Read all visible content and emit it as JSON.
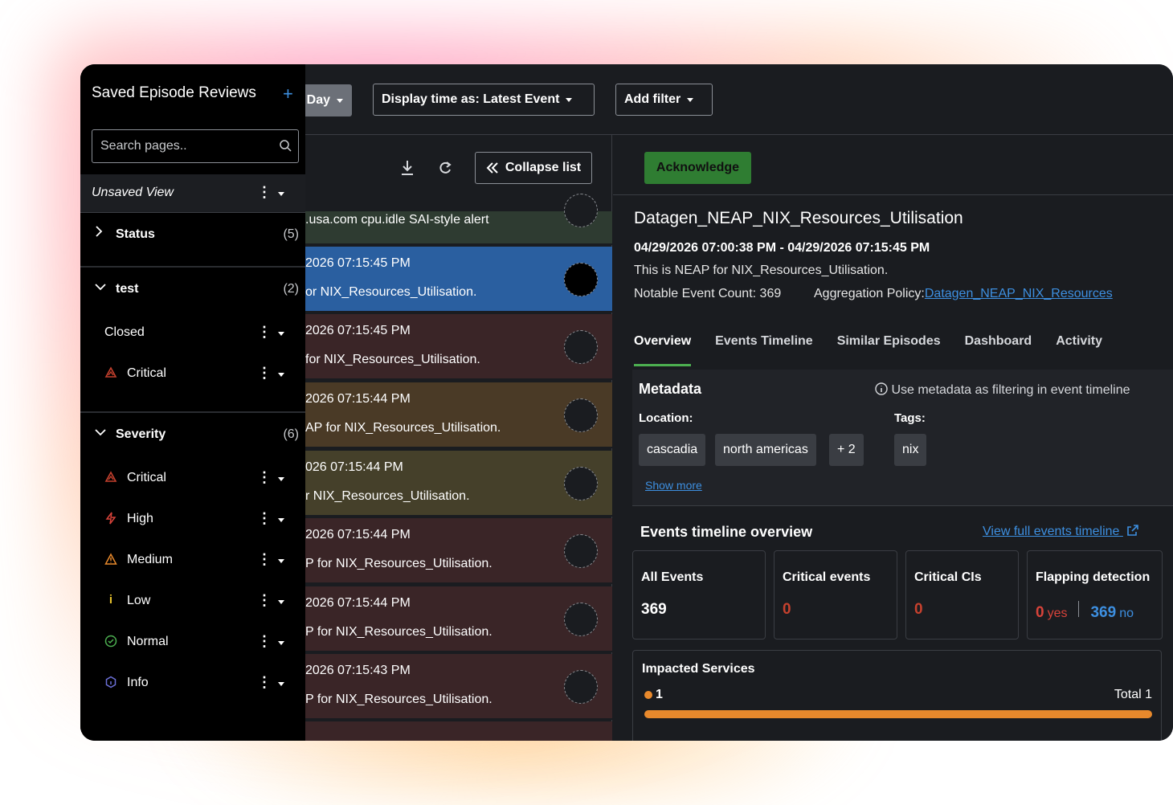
{
  "topbar": {
    "day_label": "Day",
    "display_time_label": "Display time as: Latest Event",
    "add_filter_label": "Add filter"
  },
  "list": {
    "collapse_label": "Collapse list",
    "rows": [
      {
        "line1": ".usa.com cpu.idle SAI-style alert",
        "line2": "",
        "bg": "#2e3b31"
      },
      {
        "line1": "2026 07:15:45 PM",
        "line2": "or NIX_Resources_Utilisation.",
        "bg": "#2a5fa0"
      },
      {
        "line1": "2026 07:15:45 PM",
        "line2": " for NIX_Resources_Utilisation.",
        "bg": "#3a2527"
      },
      {
        "line1": "2026 07:15:44 PM",
        "line2": "AP for NIX_Resources_Utilisation.",
        "bg": "#4a3a26"
      },
      {
        "line1": "026 07:15:44 PM",
        "line2": "r NIX_Resources_Utilisation.",
        "bg": "#45402a"
      },
      {
        "line1": "2026 07:15:44 PM",
        "line2": "P for NIX_Resources_Utilisation.",
        "bg": "#3a2527"
      },
      {
        "line1": "2026 07:15:44 PM",
        "line2": "P for NIX_Resources_Utilisation.",
        "bg": "#3a2527"
      },
      {
        "line1": "2026 07:15:43 PM",
        "line2": "P for NIX_Resources_Utilisation.",
        "bg": "#3a2527"
      }
    ]
  },
  "detail": {
    "acknowledge_label": "Acknowledge",
    "title": "Datagen_NEAP_NIX_Resources_Utilisation",
    "time_range": "04/29/2026 07:00:38 PM - 04/29/2026 07:15:45 PM",
    "description": "This is NEAP for NIX_Resources_Utilisation.",
    "notable_count": "Notable Event Count: 369",
    "aggregation_label": "Aggregation Policy:",
    "aggregation_link": "Datagen_NEAP_NIX_Resources",
    "tabs": [
      "Overview",
      "Events Timeline",
      "Similar Episodes",
      "Dashboard",
      "Activity"
    ],
    "metadata": {
      "title": "Metadata",
      "hint": "Use metadata as filtering in event timeline",
      "location_label": "Location:",
      "tags_label": "Tags:",
      "locations": [
        "cascadia",
        "north americas",
        "+ 2"
      ],
      "tags": [
        "nix"
      ],
      "show_more": "Show more"
    },
    "timeline": {
      "title": "Events timeline overview",
      "link": "View full events timeline",
      "cards": {
        "all_events_label": "All Events",
        "all_events_value": "369",
        "critical_events_label": "Critical events",
        "critical_events_value": "0",
        "critical_cis_label": "Critical CIs",
        "critical_cis_value": "0",
        "flapping_label": "Flapping detection",
        "flapping_yes_value": "0",
        "flapping_yes_label": "yes",
        "flapping_no_value": "369",
        "flapping_no_label": "no"
      }
    },
    "impacted": {
      "title": "Impacted Services",
      "count": "1",
      "total": "Total 1",
      "fraction": 1.0
    }
  },
  "sidebar": {
    "title": "Saved Episode Reviews",
    "plus": "+",
    "search_placeholder": "Search pages..",
    "unsaved_view": "Unsaved View",
    "groups": {
      "status": {
        "name": "Status",
        "count": "(5)"
      },
      "test": {
        "name": "test",
        "count": "(2)",
        "items": [
          "Closed",
          "Critical"
        ]
      },
      "severity": {
        "name": "Severity",
        "count": "(6)",
        "items": [
          "Critical",
          "High",
          "Medium",
          "Low",
          "Normal",
          "Info"
        ]
      }
    }
  },
  "colors": {
    "accent_green": "#2f7d32",
    "link_blue": "#3d8fe0",
    "critical": "#c6412e",
    "high": "#d8433a",
    "medium": "#e8892c",
    "low": "#e8c22c",
    "normal": "#4caf50",
    "info": "#6b6fd6"
  }
}
